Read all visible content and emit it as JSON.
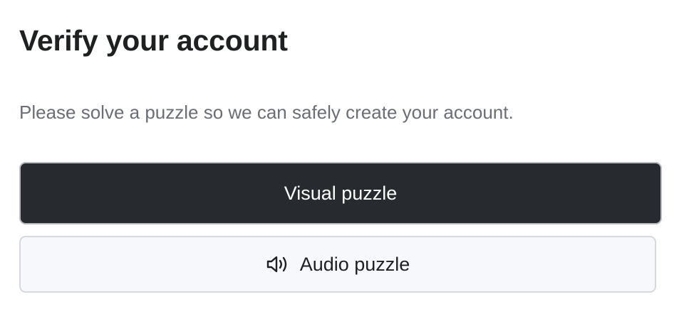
{
  "page": {
    "title": "Verify your account",
    "subtitle": "Please solve a puzzle so we can safely create your account."
  },
  "buttons": {
    "visual_label": "Visual puzzle",
    "audio_label": "Audio puzzle",
    "audio_icon": "speaker-icon"
  },
  "colors": {
    "primary_button_bg": "#272a2f",
    "secondary_button_bg": "#f7f8fb",
    "title_text": "#1f2022",
    "subtitle_text": "#6b6e75"
  }
}
